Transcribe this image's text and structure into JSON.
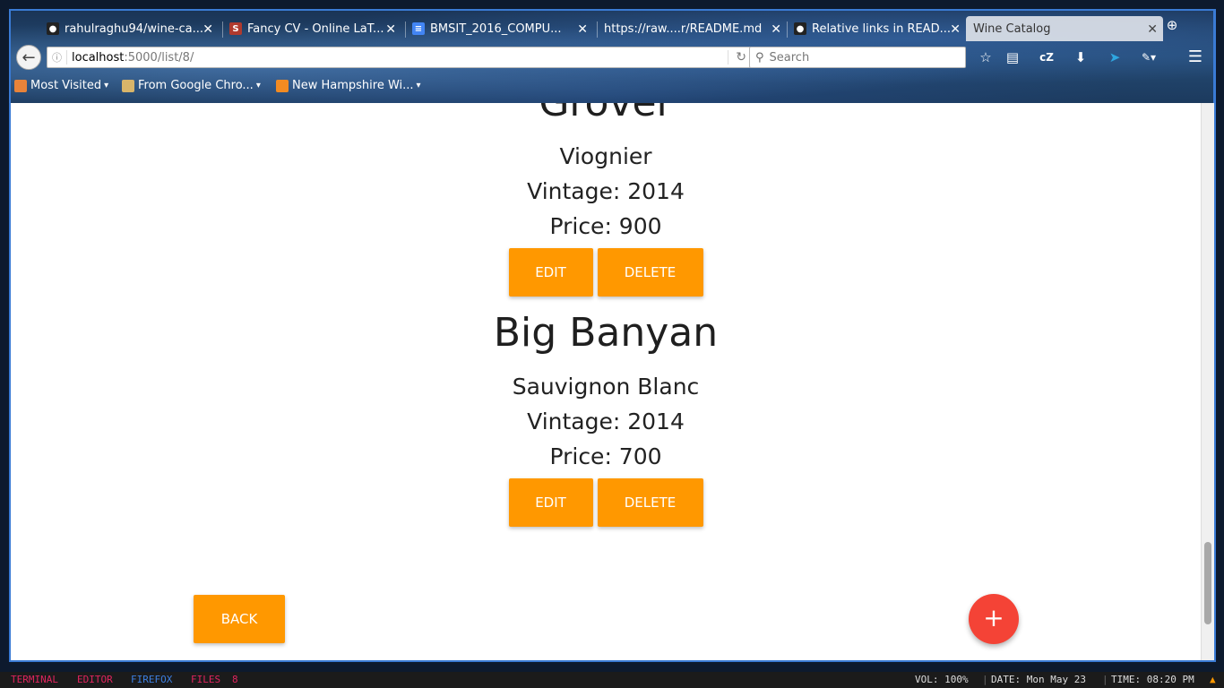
{
  "browser": {
    "tabs": [
      {
        "title": "rahulraghu94/wine-ca...",
        "icon": "github-icon",
        "active": false
      },
      {
        "title": "Fancy CV - Online LaT...",
        "icon": "sharelatex-icon",
        "active": false
      },
      {
        "title": "BMSIT_2016_COMPU...",
        "icon": "docs-icon",
        "active": false
      },
      {
        "title": "https://raw....r/README.md",
        "icon": "",
        "active": false
      },
      {
        "title": "Relative links in READ...",
        "icon": "github-icon",
        "active": false
      },
      {
        "title": "Wine Catalog",
        "icon": "",
        "active": true
      }
    ],
    "url_host": "localhost",
    "url_path": ":5000/list/8/",
    "search_placeholder": "Search",
    "toolbar_text": "cZ",
    "bookmarks": [
      {
        "label": "Most Visited",
        "icon": "most-visited-icon"
      },
      {
        "label": "From Google Chro...",
        "icon": "folder-icon"
      },
      {
        "label": "New Hampshire Wi...",
        "icon": "rss-icon"
      }
    ]
  },
  "wines": [
    {
      "name": "Grover",
      "variety": "Viognier",
      "vintage": "Vintage: 2014",
      "price": "Price: 900",
      "edit_label": "EDIT",
      "delete_label": "DELETE"
    },
    {
      "name": "Big Banyan",
      "variety": "Sauvignon Blanc",
      "vintage": "Vintage: 2014",
      "price": "Price: 700",
      "edit_label": "EDIT",
      "delete_label": "DELETE"
    }
  ],
  "page": {
    "back_label": "BACK",
    "add_label": "+"
  },
  "statusbar": {
    "workspaces": [
      {
        "label": "TERMINAL",
        "color": "#e0245e"
      },
      {
        "label": "EDITOR",
        "color": "#e0245e"
      },
      {
        "label": "FIREFOX",
        "color": "#3d7fe0"
      },
      {
        "label": "FILES",
        "color": "#e0245e"
      },
      {
        "label": "8",
        "color": "#e0245e"
      }
    ],
    "vol": "VOL:  100%",
    "date": "DATE:  Mon May 23",
    "time": "TIME:   08:20 PM"
  },
  "colors": {
    "accent": "#ff9800",
    "fab": "#f44336",
    "frame": "#3a7bd5"
  }
}
